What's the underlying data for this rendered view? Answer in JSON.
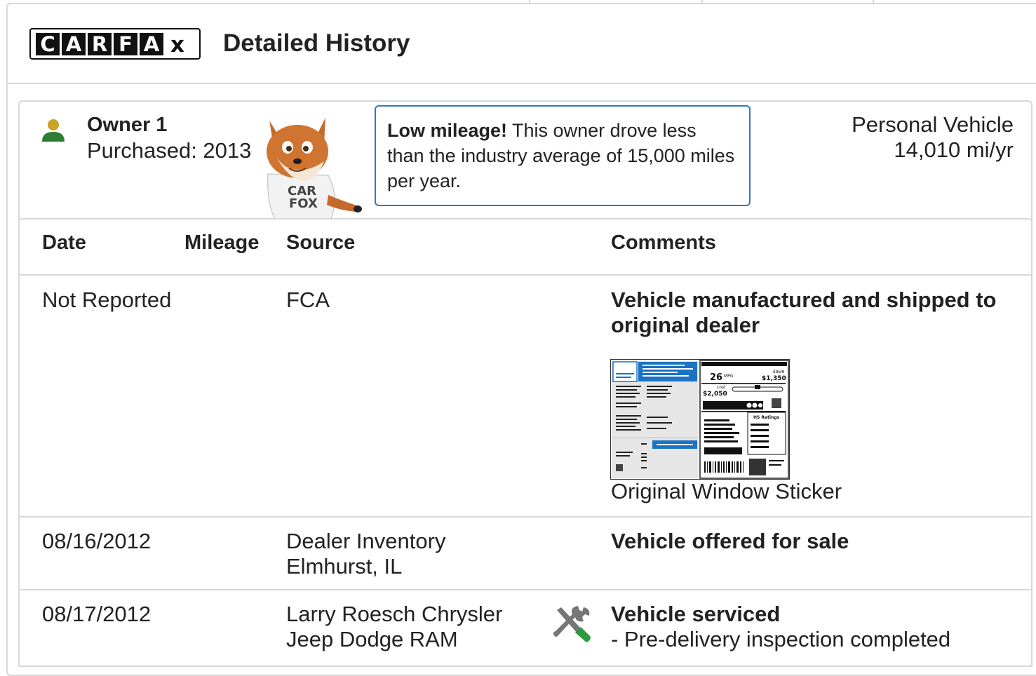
{
  "header": {
    "logo_letters": [
      "C",
      "A",
      "R",
      "F",
      "A",
      "X"
    ],
    "title": "Detailed History"
  },
  "owner": {
    "name": "Owner 1",
    "purchased": "Purchased: 2013",
    "callout_bold": "Low mileage!",
    "callout_text": " This owner drove less than the industry average of 15,000 miles per year.",
    "vehicle_type": "Personal Vehicle",
    "mileage_per_year": "14,010 mi/yr",
    "mascot_shirt": [
      "CAR",
      "FOX"
    ]
  },
  "table": {
    "headers": {
      "date": "Date",
      "mileage": "Mileage",
      "source": "Source",
      "comments": "Comments"
    },
    "rows": [
      {
        "date": "Not Reported",
        "mileage": "",
        "source_line1": "FCA",
        "source_line2": "",
        "comment_title": "Vehicle manufactured and shipped to original dealer",
        "attachment_label": "Original Window Sticker"
      },
      {
        "date": "08/16/2012",
        "mileage": "",
        "source_line1": "Dealer Inventory",
        "source_line2": "Elmhurst, IL",
        "comment_title": "Vehicle offered for sale"
      },
      {
        "date": "08/17/2012",
        "mileage": "",
        "source_line1": "Larry Roesch Chrysler",
        "source_line2": "Jeep Dodge RAM",
        "comment_title": "Vehicle serviced",
        "comment_detail": "- Pre-delivery inspection completed",
        "icon": "wrench-screwdriver-icon"
      }
    ]
  },
  "sticker": {
    "mpg": "26",
    "mpg_unit": "MPG",
    "save_label": "save",
    "save_value": "$1,350",
    "cost_label": "cost",
    "cost_value": "$2,050",
    "ratings_label": "HS Ratings"
  },
  "colors": {
    "border": "#d8d8d8",
    "callout_border": "#3777bc",
    "person_head": "#c9a227",
    "person_body": "#2e7d32",
    "sticker_blue": "#1a73c4"
  }
}
